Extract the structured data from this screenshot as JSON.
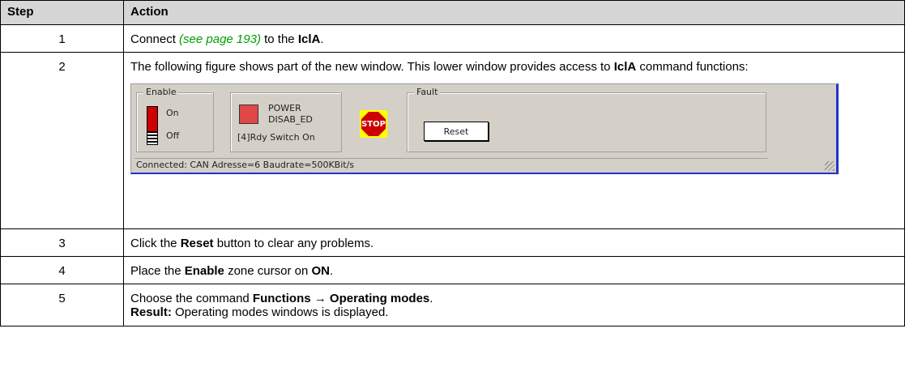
{
  "table": {
    "header": {
      "step": "Step",
      "action": "Action"
    },
    "rows": [
      {
        "num": "1",
        "pre": "Connect ",
        "link": "(see page 193)",
        "mid": " to the ",
        "bold": "IclA",
        "post": "."
      },
      {
        "num": "2",
        "text": "The following figure shows part of the new window. This lower window provides access to ",
        "bold": "IclA",
        "post": " command functions:"
      },
      {
        "num": "3",
        "pre": "Click the ",
        "bold": "Reset",
        "post": " button to clear any problems."
      },
      {
        "num": "4",
        "pre": "Place the ",
        "bold": "Enable",
        "mid": " zone cursor on ",
        "bold2": "ON",
        "post": "."
      },
      {
        "num": "5",
        "pre": "Choose the command ",
        "bold": "Functions → Operating modes",
        "post": ".",
        "result_label": "Result:",
        "result_text": " Operating modes windows is displayed."
      }
    ]
  },
  "window": {
    "enable": {
      "title": "Enable",
      "on": "On",
      "off": "Off"
    },
    "power": {
      "line1": "POWER",
      "line2": "DISAB_ED",
      "state": "[4]Rdy Switch On"
    },
    "stop": "STOP",
    "fault": {
      "title": "Fault",
      "reset": "Reset"
    },
    "status": "Connected: CAN Adresse=6 Baudrate=500KBit/s"
  },
  "colors": {
    "header_bg": "#d6d6d6",
    "link": "#00a000",
    "window_bg": "#d4d0c8",
    "window_border": "#2233cc"
  }
}
